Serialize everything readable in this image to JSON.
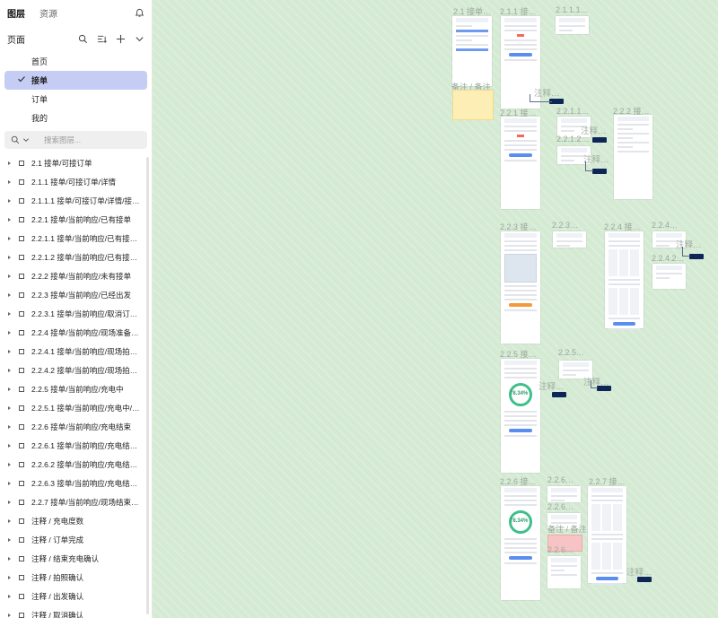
{
  "sidebar": {
    "tabs": [
      "图层",
      "资源"
    ],
    "pages_title": "页面",
    "pages": [
      "首页",
      "接单",
      "订单",
      "我的"
    ],
    "search_placeholder": "搜索图层...",
    "layers": [
      "2.1 接单/可接订单",
      "2.1.1 接单/可接订单/详情",
      "2.1.1.1 接单/可接订单/详情/接…",
      "2.2.1 接单/当前响应/已有接单",
      "2.2.1.1 接单/当前响应/已有接…",
      "2.2.1.2 接单/当前响应/已有接…",
      "2.2.2 接单/当前响应/未有接单",
      "2.2.3 接单/当前响应/已经出发",
      "2.2.3.1 接单/当前响应/取消订…",
      "2.2.4 接单/当前响应/现场准备…",
      "2.2.4.1 接单/当前响应/现场拍…",
      "2.2.4.2 接单/当前响应/现场拍…",
      "2.2.5 接单/当前响应/充电中",
      "2.2.5.1 接单/当前响应/充电中/…",
      "2.2.6 接单/当前响应/充电结束",
      "2.2.6.1 接单/当前响应/充电结…",
      "2.2.6.2 接单/当前响应/充电结…",
      "2.2.6.3 接单/当前响应/充电结…",
      "2.2.7 接单/当前响应/现场结束…",
      "注释 / 充电度数",
      "注释 / 订单完成",
      "注释 / 结束充电确认",
      "注释 / 拍照确认",
      "注释 / 出发确认",
      "注释 / 取消确认"
    ]
  },
  "canvas": {
    "frame_labels": [
      "2.1 接单…",
      "2.1.1 接…",
      "2.1.1.1…",
      "2.2.1 接…",
      "2.2.1.1…",
      "2.2.2 接…",
      "2.2.1.2…",
      "2.2.3 接…",
      "2.2.3…",
      "2.2.4 接…",
      "2.2.4…",
      "2.2.4.2…",
      "2.2.5 接…",
      "2.2.5…",
      "2.2.6 接…",
      "2.2.6…",
      "2.2.7 接…",
      "2.2.6…",
      "2.2.6…"
    ],
    "annotation_labels": [
      "注释…",
      "注释…",
      "注释…",
      "注释…",
      "注释…",
      "注释…",
      "注释…",
      "注释…"
    ],
    "overlay_labels": [
      "备注 / 备注",
      "备注 / 备注"
    ],
    "frame_texts": [
      "78.34%",
      "78.34%"
    ]
  }
}
